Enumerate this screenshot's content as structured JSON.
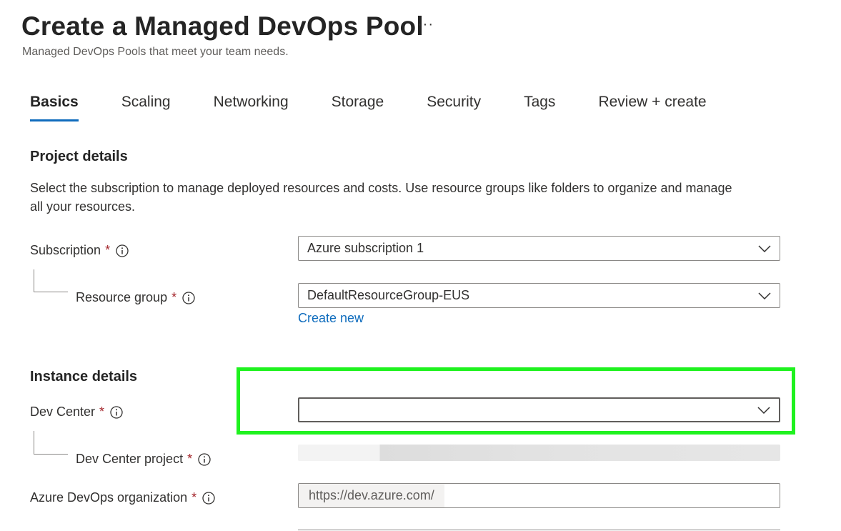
{
  "header": {
    "title": "Create a Managed DevOps Pool",
    "more_label": "···",
    "subtitle": "Managed DevOps Pools that meet your team needs."
  },
  "tabs": [
    {
      "label": "Basics",
      "active": true
    },
    {
      "label": "Scaling",
      "active": false
    },
    {
      "label": "Networking",
      "active": false
    },
    {
      "label": "Storage",
      "active": false
    },
    {
      "label": "Security",
      "active": false
    },
    {
      "label": "Tags",
      "active": false
    },
    {
      "label": "Review + create",
      "active": false
    }
  ],
  "project_details": {
    "title": "Project details",
    "description": "Select the subscription to manage deployed resources and costs. Use resource groups like folders to organize and manage all your resources.",
    "subscription": {
      "label": "Subscription",
      "required": "*",
      "value": "Azure subscription 1"
    },
    "resource_group": {
      "label": "Resource group",
      "required": "*",
      "value": "DefaultResourceGroup-EUS",
      "create_new_label": "Create new"
    }
  },
  "instance_details": {
    "title": "Instance details",
    "dev_center": {
      "label": "Dev Center",
      "required": "*",
      "value": ""
    },
    "dev_center_project": {
      "label": "Dev Center project",
      "required": "*"
    },
    "azure_devops_org": {
      "label": "Azure DevOps organization",
      "required": "*",
      "prefix": "https://dev.azure.com/",
      "value": ""
    }
  },
  "colors": {
    "accent": "#0f6cbd",
    "highlight": "#1ff21f",
    "required": "#a4262c"
  },
  "icons": {
    "info": "info-icon",
    "chevron": "chevron-down-icon",
    "more": "more-icon"
  }
}
